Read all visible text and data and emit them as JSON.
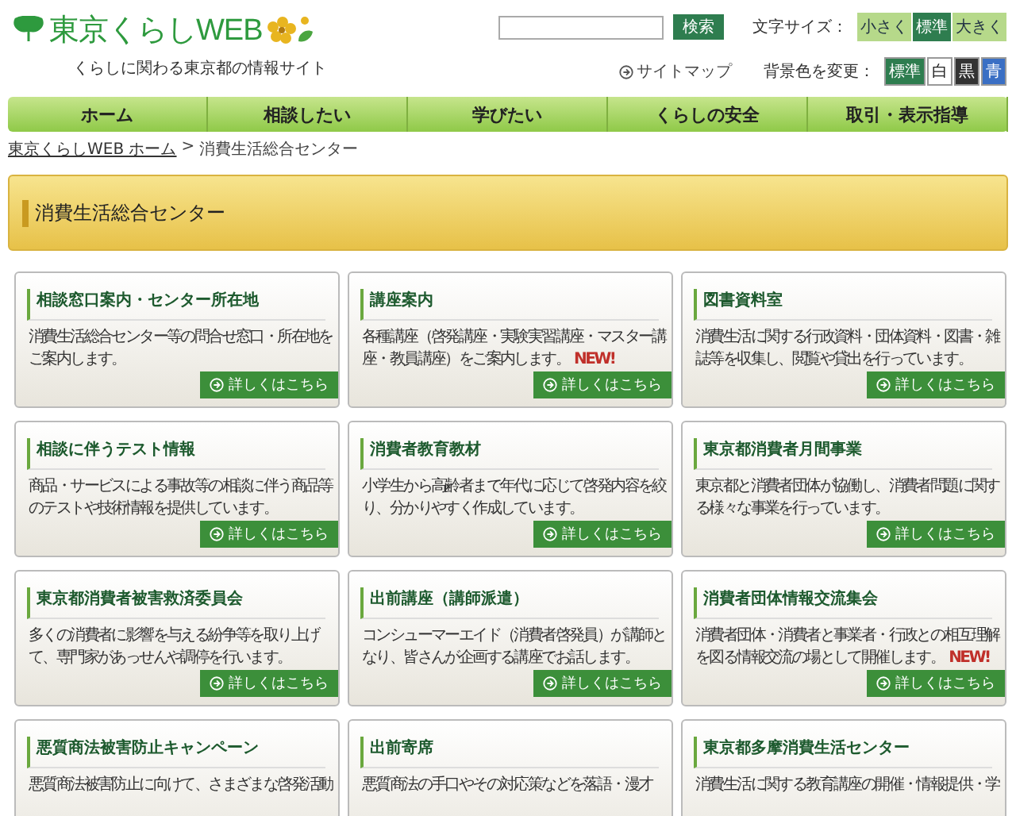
{
  "header": {
    "logo": "東京くらしWEB",
    "tagline": "くらしに関わる東京都の情報サイト",
    "search": {
      "button": "検索"
    },
    "sitemap": "サイトマップ",
    "font_size": {
      "label": "文字サイズ：",
      "options": [
        {
          "label": "小さく",
          "selected": false
        },
        {
          "label": "標準",
          "selected": true
        },
        {
          "label": "大きく",
          "selected": false
        }
      ]
    },
    "bg_color": {
      "label": "背景色を変更：",
      "options": [
        {
          "label": "標準",
          "color": "#2e7d4f"
        },
        {
          "label": "白",
          "color": "#ffffff"
        },
        {
          "label": "黒",
          "color": "#333333"
        },
        {
          "label": "青",
          "color": "#3a6fc4"
        }
      ]
    }
  },
  "nav": [
    "ホーム",
    "相談したい",
    "学びたい",
    "くらしの安全",
    "取引・表示指導"
  ],
  "breadcrumb": {
    "home": "東京くらしWEB ホーム",
    "separator": ">",
    "current": "消費生活総合センター"
  },
  "banner": "消費生活総合センター",
  "cards": [
    {
      "title": "相談窓口案内・センター所在地",
      "body": "消費生活総合センター等の問合せ窓口・所在地をご案内します。",
      "link": "詳しくはこちら"
    },
    {
      "title": "講座案内",
      "body": "各種講座（啓発講座・実験実習講座・マスター講座・教員講座）をご案内します。",
      "badge": "NEW!",
      "link": "詳しくはこちら"
    },
    {
      "title": "図書資料室",
      "body": "消費生活に関する行政資料・団体資料・図書・雑誌等を収集し、閲覧や貸出を行っています。",
      "link": "詳しくはこちら"
    },
    {
      "title": "相談に伴うテスト情報",
      "body": "商品・サービスによる事故等の相談に伴う商品等のテストや技術情報を提供しています。",
      "link": "詳しくはこちら"
    },
    {
      "title": "消費者教育教材",
      "body": "小学生から高齢者まで年代に応じて啓発内容を絞り、分かりやすく作成しています。",
      "link": "詳しくはこちら"
    },
    {
      "title": "東京都消費者月間事業",
      "body": "東京都と消費者団体が協働し、消費者問題に関する様々な事業を行っています。",
      "link": "詳しくはこちら"
    },
    {
      "title": "東京都消費者被害救済委員会",
      "body": "多くの消費者に影響を与える紛争等を取り上げて、専門家があっせんや調停を行います。",
      "link": "詳しくはこちら"
    },
    {
      "title": "出前講座（講師派遣）",
      "body": "コンシューマーエイド（消費者啓発員）が講師となり、皆さんが企画する講座でお話します。",
      "link": "詳しくはこちら"
    },
    {
      "title": "消費者団体情報交流集会",
      "body": "消費者団体・消費者と事業者・行政との相互理解を図る情報交流の場として開催します。",
      "badge": "NEW!",
      "link": "詳しくはこちら"
    },
    {
      "title": "悪質商法被害防止キャンペーン",
      "body": "悪質商法被害防止に向けて、さまざまな啓発活動"
    },
    {
      "title": "出前寄席",
      "body": "悪質商法の手口やその対応策などを落語・漫才"
    },
    {
      "title": "東京都多摩消費生活センター",
      "body": "消費生活に関する教育講座の開催・情報提供・学"
    }
  ]
}
